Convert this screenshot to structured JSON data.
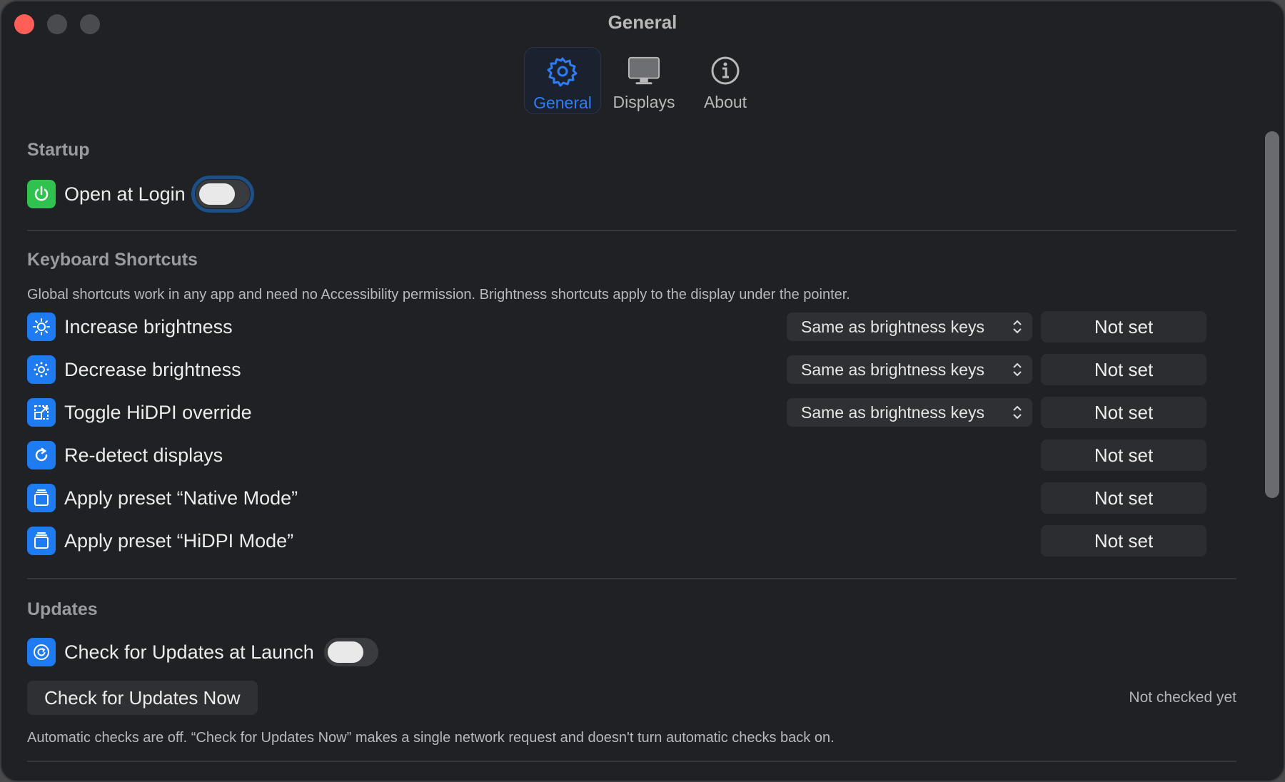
{
  "window": {
    "title": "General"
  },
  "tabs": [
    {
      "label": "General",
      "icon": "gear-icon",
      "active": true
    },
    {
      "label": "Displays",
      "icon": "display-icon",
      "active": false
    },
    {
      "label": "About",
      "icon": "info-icon",
      "active": false
    }
  ],
  "startup": {
    "title": "Startup",
    "open_at_login": {
      "label": "Open at Login",
      "icon": "power-icon",
      "on": false
    }
  },
  "shortcuts": {
    "title": "Keyboard Shortcuts",
    "description": "Global shortcuts work in any app and need no Accessibility permission. Brightness shortcuts apply to the display under the pointer.",
    "items": [
      {
        "label": "Increase brightness",
        "icon": "sun-icon",
        "popup": "Same as brightness keys",
        "shortcut": "Not set"
      },
      {
        "label": "Decrease brightness",
        "icon": "sun-small-icon",
        "popup": "Same as brightness keys",
        "shortcut": "Not set"
      },
      {
        "label": "Toggle HiDPI override",
        "icon": "resize-icon",
        "popup": "Same as brightness keys",
        "shortcut": "Not set"
      },
      {
        "label": "Re-detect displays",
        "icon": "refresh-icon",
        "shortcut": "Not set"
      },
      {
        "label": "Apply preset “Native Mode”",
        "icon": "stack-icon",
        "shortcut": "Not set"
      },
      {
        "label": "Apply preset “HiDPI Mode”",
        "icon": "stack-icon",
        "shortcut": "Not set"
      }
    ]
  },
  "updates": {
    "title": "Updates",
    "check_at_launch": {
      "label": "Check for Updates at Launch",
      "icon": "update-icon",
      "on": false
    },
    "check_now_label": "Check for Updates Now",
    "status": "Not checked yet",
    "note": "Automatic checks are off. “Check for Updates Now” makes a single network request and doesn't turn automatic checks back on."
  },
  "colors": {
    "accent": "#2f7df6",
    "close": "#ff5f57",
    "green_icon": "#2fc24f",
    "blue_icon": "#1f7bf2"
  }
}
